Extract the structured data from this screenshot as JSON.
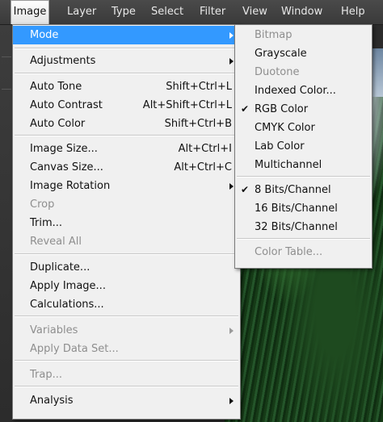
{
  "menubar": {
    "items": [
      "Image",
      "Layer",
      "Type",
      "Select",
      "Filter",
      "View",
      "Window",
      "Help"
    ],
    "active_index": 0
  },
  "image_menu": {
    "items": [
      {
        "label": "Mode",
        "shortcut": "",
        "submenu": true,
        "disabled": false,
        "highlight": true
      },
      {
        "label": "Adjustments",
        "shortcut": "",
        "submenu": true,
        "disabled": false
      },
      {
        "label": "Auto Tone",
        "shortcut": "Shift+Ctrl+L",
        "submenu": false,
        "disabled": false
      },
      {
        "label": "Auto Contrast",
        "shortcut": "Alt+Shift+Ctrl+L",
        "submenu": false,
        "disabled": false
      },
      {
        "label": "Auto Color",
        "shortcut": "Shift+Ctrl+B",
        "submenu": false,
        "disabled": false
      },
      {
        "label": "Image Size...",
        "shortcut": "Alt+Ctrl+I",
        "submenu": false,
        "disabled": false
      },
      {
        "label": "Canvas Size...",
        "shortcut": "Alt+Ctrl+C",
        "submenu": false,
        "disabled": false
      },
      {
        "label": "Image Rotation",
        "shortcut": "",
        "submenu": true,
        "disabled": false
      },
      {
        "label": "Crop",
        "shortcut": "",
        "submenu": false,
        "disabled": true
      },
      {
        "label": "Trim...",
        "shortcut": "",
        "submenu": false,
        "disabled": false
      },
      {
        "label": "Reveal All",
        "shortcut": "",
        "submenu": false,
        "disabled": true
      },
      {
        "label": "Duplicate...",
        "shortcut": "",
        "submenu": false,
        "disabled": false
      },
      {
        "label": "Apply Image...",
        "shortcut": "",
        "submenu": false,
        "disabled": false
      },
      {
        "label": "Calculations...",
        "shortcut": "",
        "submenu": false,
        "disabled": false
      },
      {
        "label": "Variables",
        "shortcut": "",
        "submenu": true,
        "disabled": true
      },
      {
        "label": "Apply Data Set...",
        "shortcut": "",
        "submenu": false,
        "disabled": true
      },
      {
        "label": "Trap...",
        "shortcut": "",
        "submenu": false,
        "disabled": true
      },
      {
        "label": "Analysis",
        "shortcut": "",
        "submenu": true,
        "disabled": false
      }
    ]
  },
  "mode_submenu": {
    "items": [
      {
        "label": "Bitmap",
        "disabled": true,
        "checked": false
      },
      {
        "label": "Grayscale",
        "disabled": false,
        "checked": false
      },
      {
        "label": "Duotone",
        "disabled": true,
        "checked": false
      },
      {
        "label": "Indexed Color...",
        "disabled": false,
        "checked": false
      },
      {
        "label": "RGB Color",
        "disabled": false,
        "checked": true
      },
      {
        "label": "CMYK Color",
        "disabled": false,
        "checked": false
      },
      {
        "label": "Lab Color",
        "disabled": false,
        "checked": false
      },
      {
        "label": "Multichannel",
        "disabled": false,
        "checked": false
      },
      {
        "label": "8 Bits/Channel",
        "disabled": false,
        "checked": true
      },
      {
        "label": "16 Bits/Channel",
        "disabled": false,
        "checked": false
      },
      {
        "label": "32 Bits/Channel",
        "disabled": false,
        "checked": false
      },
      {
        "label": "Color Table...",
        "disabled": true,
        "checked": false
      }
    ],
    "check_glyph": "✔"
  },
  "colors": {
    "highlight": "#3399ff",
    "menu_bg": "#f0f0f0",
    "menubar_bg": "#3f3f3f",
    "disabled_text": "#8e8e8e"
  }
}
